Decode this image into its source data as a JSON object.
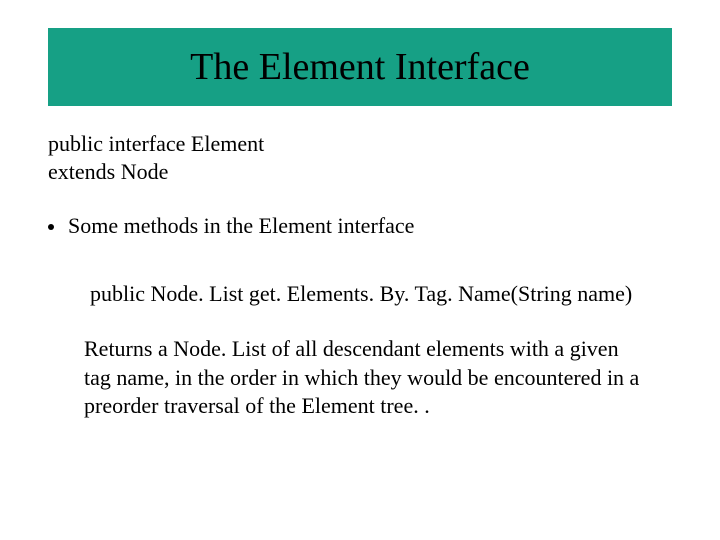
{
  "title": "The Element Interface",
  "declaration_line1": "public interface Element",
  "declaration_line2": "extends Node",
  "bullet": "Some methods in the Element interface",
  "method_signature": "public Node. List get. Elements. By. Tag. Name(String name)",
  "method_description": "Returns a Node. List of all descendant elements with a given tag name, in the order in which they would be encountered in a preorder traversal of the Element tree. ."
}
